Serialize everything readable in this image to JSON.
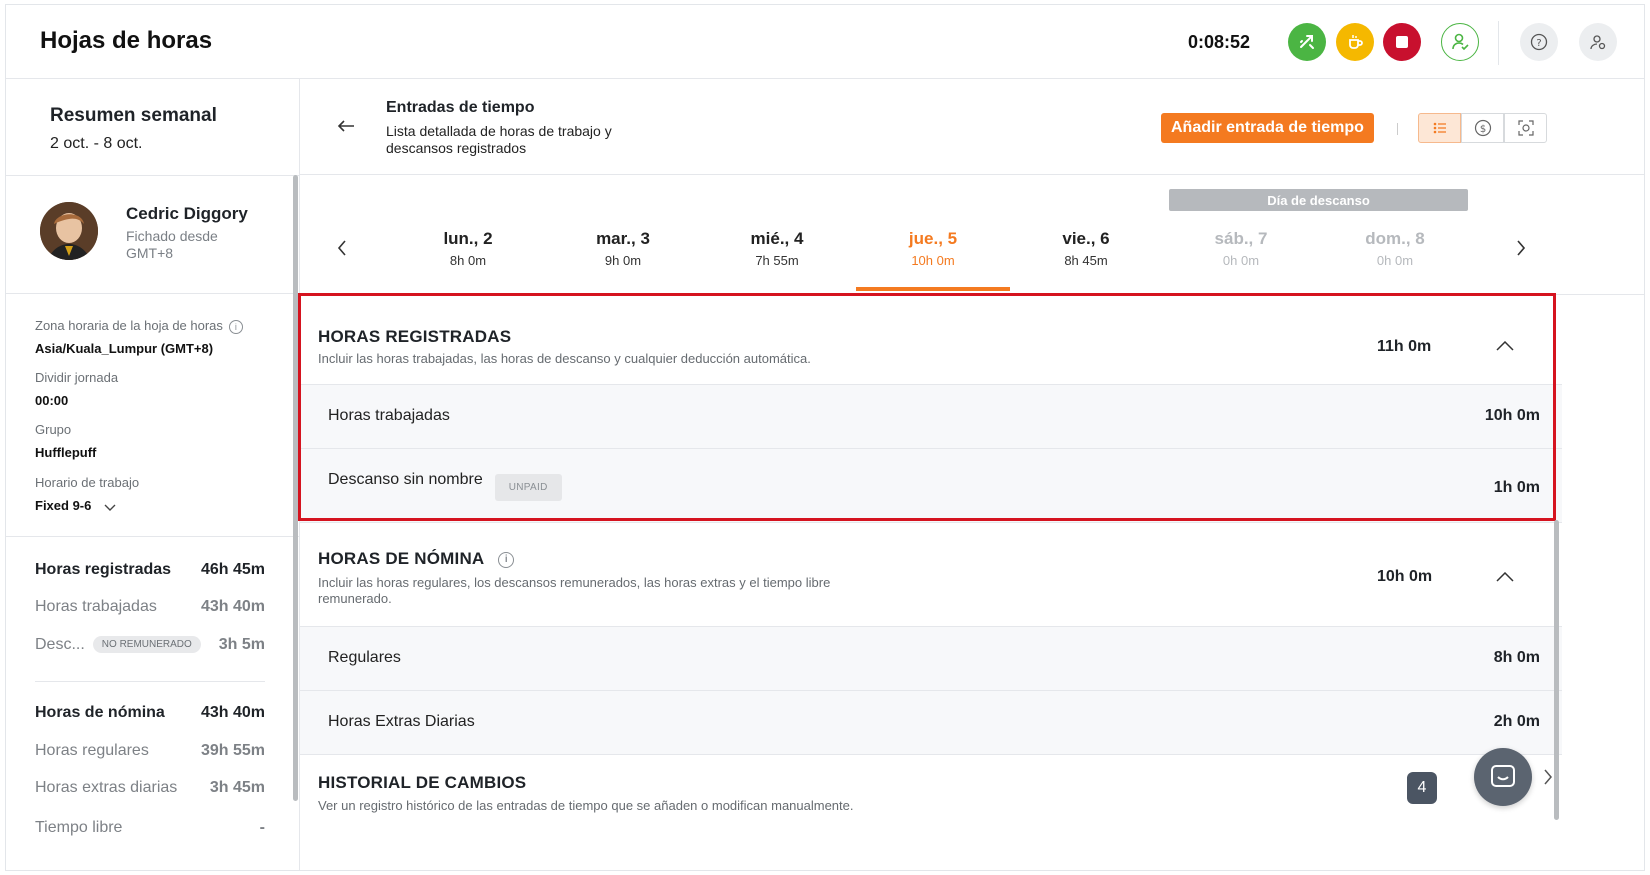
{
  "header": {
    "title": "Hojas de horas",
    "timer": "0:08:52"
  },
  "weekly": {
    "title": "Resumen semanal",
    "range": "2 oct. - 8 oct."
  },
  "user": {
    "name": "Cedric Diggory",
    "status": "Fichado desde GMT+8"
  },
  "details": {
    "timezone_label": "Zona horaria de la hoja de horas",
    "timezone_value": "Asia/Kuala_Lumpur (GMT+8)",
    "split_label": "Dividir jornada",
    "split_value": "00:00",
    "group_label": "Grupo",
    "group_value": "Hufflepuff",
    "schedule_label": "Horario de trabajo",
    "schedule_value": "Fixed 9-6"
  },
  "summary": {
    "tracked_label": "Horas registradas",
    "tracked_value": "46h 45m",
    "worked_label": "Horas trabajadas",
    "worked_value": "43h 40m",
    "break_label": "Desc...",
    "break_badge": "NO REMUNERADO",
    "break_value": "3h 5m",
    "payroll_label": "Horas de nómina",
    "payroll_value": "43h 40m",
    "regular_label": "Horas regulares",
    "regular_value": "39h 55m",
    "overtime_label": "Horas extras diarias",
    "overtime_value": "3h 45m",
    "timeoff_label": "Tiempo libre",
    "timeoff_value": "-"
  },
  "entries": {
    "title": "Entradas de tiempo",
    "description": "Lista detallada de horas de trabajo y descansos registrados",
    "add_button": "Añadir entrada de tiempo"
  },
  "days": {
    "rest_banner": "Día de descanso",
    "items": [
      {
        "day": "lun., 2",
        "hours": "8h 0m"
      },
      {
        "day": "mar., 3",
        "hours": "9h 0m"
      },
      {
        "day": "mié., 4",
        "hours": "7h 55m"
      },
      {
        "day": "jue., 5",
        "hours": "10h 0m"
      },
      {
        "day": "vie., 6",
        "hours": "8h 45m"
      },
      {
        "day": "sáb., 7",
        "hours": "0h 0m"
      },
      {
        "day": "dom., 8",
        "hours": "0h 0m"
      }
    ]
  },
  "tracked": {
    "title": "HORAS REGISTRADAS",
    "description": "Incluir las horas trabajadas, las horas de descanso y cualquier deducción automática.",
    "total": "11h 0m",
    "rows": [
      {
        "label": "Horas trabajadas",
        "value": "10h 0m"
      },
      {
        "label": "Descanso sin nombre",
        "badge": "UNPAID",
        "value": "1h 0m"
      }
    ]
  },
  "payroll": {
    "title": "HORAS DE NÓMINA",
    "description": "Incluir las horas regulares, los descansos remunerados, las horas extras y el tiempo libre remunerado.",
    "total": "10h 0m",
    "rows": [
      {
        "label": "Regulares",
        "value": "8h 0m"
      },
      {
        "label": "Horas Extras Diarias",
        "value": "2h 0m"
      }
    ]
  },
  "history": {
    "title": "HISTORIAL DE CAMBIOS",
    "description": "Ver un registro histórico de las entradas de tiempo que se añaden o modifican manualmente.",
    "count": "4"
  },
  "colors": {
    "accent": "#f47a20",
    "highlight": "#d5131f",
    "green": "#4bb543",
    "yellow": "#f5b800",
    "red": "#c8102e"
  }
}
